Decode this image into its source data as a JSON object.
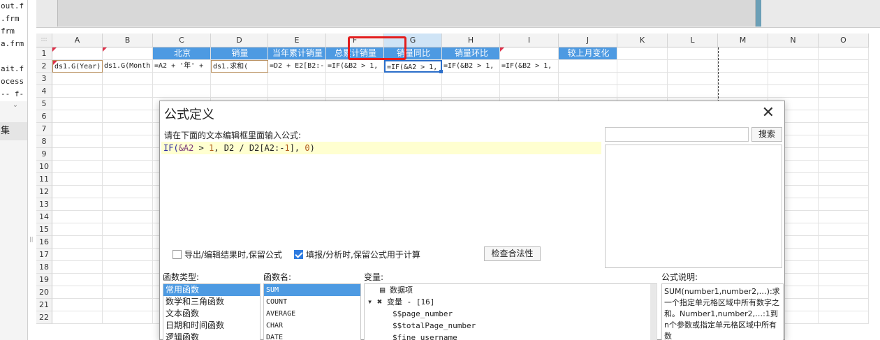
{
  "left_panel": {
    "files": [
      "out.f",
      ".frm",
      "frm",
      "a.frm",
      "",
      "ait.f",
      "ocess",
      "-- f-"
    ],
    "scroll_glyph": "⌄",
    "dataset_label": "集",
    "splitter_glyph": "||"
  },
  "grid": {
    "corner_glyph": ":::",
    "columns": [
      "A",
      "B",
      "C",
      "D",
      "E",
      "F",
      "G",
      "H",
      "I",
      "J",
      "K",
      "L",
      "M",
      "N",
      "O"
    ],
    "rows": [
      "1",
      "2",
      "3",
      "4",
      "5",
      "6",
      "7",
      "8",
      "9",
      "10",
      "11",
      "12",
      "13",
      "14",
      "15",
      "16",
      "17",
      "18",
      "19",
      "20",
      "21",
      "22"
    ],
    "row1": {
      "C": "北京",
      "D": "销量",
      "E": "当年累计销量",
      "F": "总累计销量",
      "G": "销量同比",
      "H": "销量环比",
      "J": "较上月变化"
    },
    "row2": {
      "A": "ds1.G(Year)",
      "B": "ds1.G(Month",
      "C": "=A2 + '年' +",
      "D": "ds1.求和(",
      "E": "=D2 + E2[B2:-",
      "F": "=IF(&B2 > 1,",
      "G": "=IF(&A2 > 1,",
      "H": "=IF(&B2 > 1,",
      "I": "=IF(&B2 > 1,"
    }
  },
  "dialog": {
    "title": "公式定义",
    "close_glyph": "✕",
    "instruction": "请在下面的文本编辑框里面输入公式:",
    "formula": {
      "p1": "IF(",
      "p2": "&A2",
      "p3": " > ",
      "p4": "1",
      "p5": ", D2 / D2[A2:-",
      "p6": "1",
      "p7": "], ",
      "p8": "0",
      "p9": ")"
    },
    "search_button": "搜索",
    "options": {
      "export_keep_formula": "导出/编辑结果时,保留公式",
      "fill_keep_formula": "填报/分析时,保留公式用于计算",
      "export_checked": false,
      "fill_checked": true
    },
    "check_validity_button": "检查合法性",
    "function_type_label": "函数类型:",
    "function_types": [
      "常用函数",
      "数学和三角函数",
      "文本函数",
      "日期和时间函数",
      "逻辑函数"
    ],
    "function_name_label": "函数名:",
    "function_names": [
      "SUM",
      "COUNT",
      "AVERAGE",
      "CHAR",
      "DATE"
    ],
    "variable_label": "变量:",
    "variables": {
      "data_item": "数据项",
      "variable_group": "变量 - [16]",
      "items": [
        "$$page_number",
        "$$totalPage_number",
        "$fine_username"
      ]
    },
    "description_label": "公式说明:",
    "description_text": "SUM(number1,number2,…):求一个指定单元格区域中所有数字之和。Number1,number2,…:1到n个参数或指定单元格区域中所有数"
  },
  "colors": {
    "header_blue": "#4d9ae2",
    "highlight_red": "#e31e1e",
    "selection_blue": "#2b6ec9",
    "formula_line_bg": "#ffffd0"
  }
}
